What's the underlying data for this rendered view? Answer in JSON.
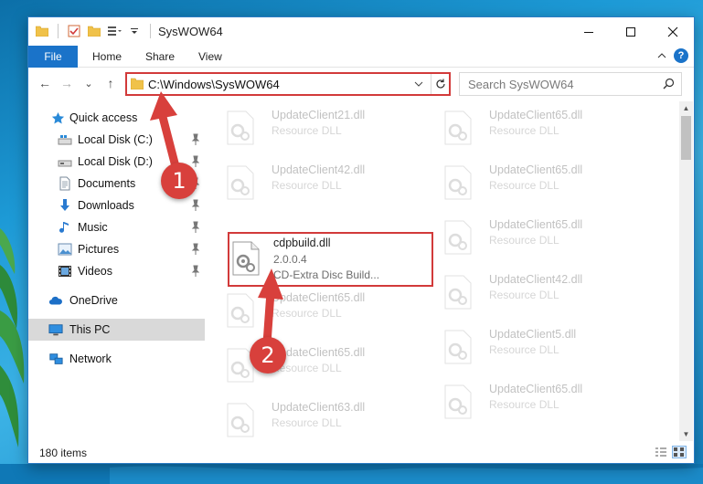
{
  "window": {
    "title": "SysWOW64",
    "controls": {
      "minimize": "—",
      "maximize": "☐",
      "close": "✕"
    }
  },
  "ribbon": {
    "tabs": [
      "File",
      "Home",
      "Share",
      "View"
    ],
    "help": "?"
  },
  "navbar": {
    "back": "←",
    "forward": "→",
    "recent": "⌄",
    "up": "↑",
    "address": "C:\\Windows\\SysWOW64",
    "search_placeholder": "Search SysWOW64"
  },
  "sidebar": {
    "items": [
      {
        "label": "Quick access",
        "icon": "star-icon"
      },
      {
        "label": "Local Disk (C:)",
        "icon": "drive-icon",
        "pinned": true
      },
      {
        "label": "Local Disk (D:)",
        "icon": "drive-icon",
        "pinned": true
      },
      {
        "label": "Documents",
        "icon": "documents-icon",
        "pinned": true
      },
      {
        "label": "Downloads",
        "icon": "download-icon",
        "pinned": true
      },
      {
        "label": "Music",
        "icon": "music-icon",
        "pinned": true
      },
      {
        "label": "Pictures",
        "icon": "pictures-icon",
        "pinned": true
      },
      {
        "label": "Videos",
        "icon": "videos-icon",
        "pinned": true
      },
      {
        "label": "OneDrive",
        "icon": "cloud-icon"
      },
      {
        "label": "This PC",
        "icon": "computer-icon",
        "selected": true
      },
      {
        "label": "Network",
        "icon": "network-icon"
      }
    ]
  },
  "files": {
    "left": [
      {
        "name": "UpdateClient21.dll",
        "desc": "Resource DLL"
      },
      {
        "name": "UpdateClient42.dll",
        "desc": "Resource DLL"
      },
      {
        "name": "cdpbuild.dll",
        "version": "2.0.0.4",
        "desc": "CD-Extra Disc Build...",
        "highlighted": true
      },
      {
        "name": "UpdateClient65.dll",
        "desc": "Resource DLL"
      },
      {
        "name": "UpdateClient65.dll",
        "desc": "Resource DLL"
      },
      {
        "name": "UpdateClient63.dll",
        "desc": "Resource DLL"
      }
    ],
    "right": [
      {
        "name": "UpdateClient65.dll",
        "desc": "Resource DLL"
      },
      {
        "name": "UpdateClient65.dll",
        "desc": "Resource DLL"
      },
      {
        "name": "UpdateClient65.dll",
        "desc": "Resource DLL"
      },
      {
        "name": "UpdateClient42.dll",
        "desc": "Resource DLL"
      },
      {
        "name": "UpdateClient5.dll",
        "desc": "Resource DLL"
      },
      {
        "name": "UpdateClient65.dll",
        "desc": "Resource DLL"
      }
    ]
  },
  "status": {
    "count": "180 items"
  },
  "callouts": {
    "step1": "1",
    "step2": "2"
  },
  "colors": {
    "accent": "#1a73c9",
    "highlight": "#d23a3a",
    "callout": "#d8403c"
  }
}
